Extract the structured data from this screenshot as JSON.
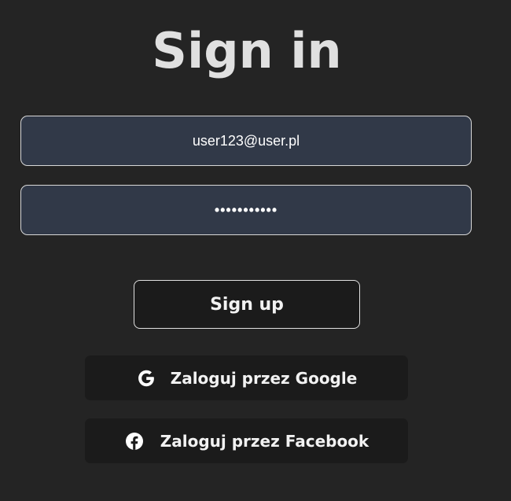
{
  "page": {
    "title": "Sign in"
  },
  "form": {
    "email_value": "user123@user.pl",
    "password_value": "•••••••••••",
    "signup_label": "Sign up"
  },
  "social": {
    "google_label": "Zaloguj przez Google",
    "google_icon": "google-icon",
    "facebook_label": "Zaloguj przez Facebook",
    "facebook_icon": "facebook-icon"
  },
  "colors": {
    "background": "#242424",
    "field_background": "#313948",
    "button_background": "#1b1b1b",
    "text": "#ffffff"
  }
}
